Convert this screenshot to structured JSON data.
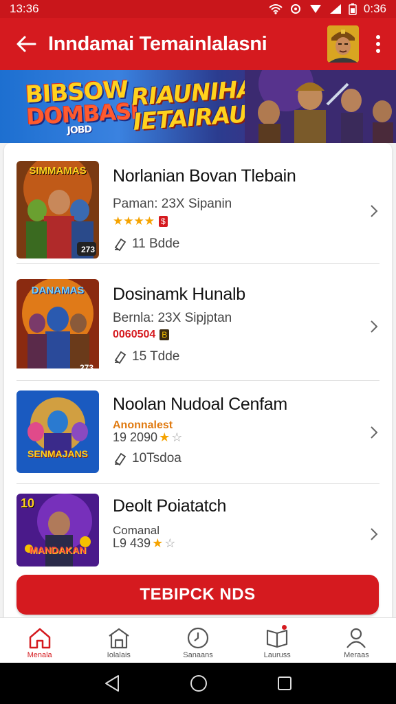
{
  "status_bar": {
    "time_left": "13:36",
    "time_right": "0:36"
  },
  "app_bar": {
    "title": "Inndamai Temainlalasni"
  },
  "banner": {
    "logo_line1": "BIBSOW",
    "logo_line2": "DOMBASI",
    "logo_line3": "JOBD",
    "headline_line1": "RIAUNIHARS",
    "headline_line2": "IETAIRAU!"
  },
  "games": [
    {
      "title": "Norlanian Bovan Tlebain",
      "subtitle": "Paman: 23X Sipanin",
      "thumb_text": "SIMMAMAS",
      "thumb_badge": "273",
      "downloads": "11 Bdde",
      "stars": "★★★★",
      "badge": "$"
    },
    {
      "title": "Dosinamk Hunalb",
      "subtitle": "Bernla: 23X Sipjptan",
      "thumb_text": "DANAMAS",
      "thumb_badge": "273",
      "downloads": "15 Tdde",
      "rating_text": "0060504",
      "badge": "B"
    },
    {
      "title": "Noolan Nudoal Cenfam",
      "subtitle": "Anonnalest",
      "secondary": "19 2090",
      "thumb_text": "SENMAJANS",
      "downloads": "10Tsdoa"
    },
    {
      "title": "Deolt Poiatatch",
      "subtitle": "Comanal",
      "secondary": "L9 439",
      "thumb_text": "MANDAKAN",
      "thumb_badge": "10"
    }
  ],
  "cta": {
    "label": "TEBIPCK NDS"
  },
  "bottom_nav": [
    {
      "label": "Menala",
      "icon": "home-icon"
    },
    {
      "label": "Iolalais",
      "icon": "store-icon"
    },
    {
      "label": "Sanaans",
      "icon": "clock-icon"
    },
    {
      "label": "Lauruss",
      "icon": "book-icon"
    },
    {
      "label": "Meraas",
      "icon": "profile-icon"
    }
  ],
  "colors": {
    "primary": "#d51a1f",
    "star": "#f5a300"
  }
}
